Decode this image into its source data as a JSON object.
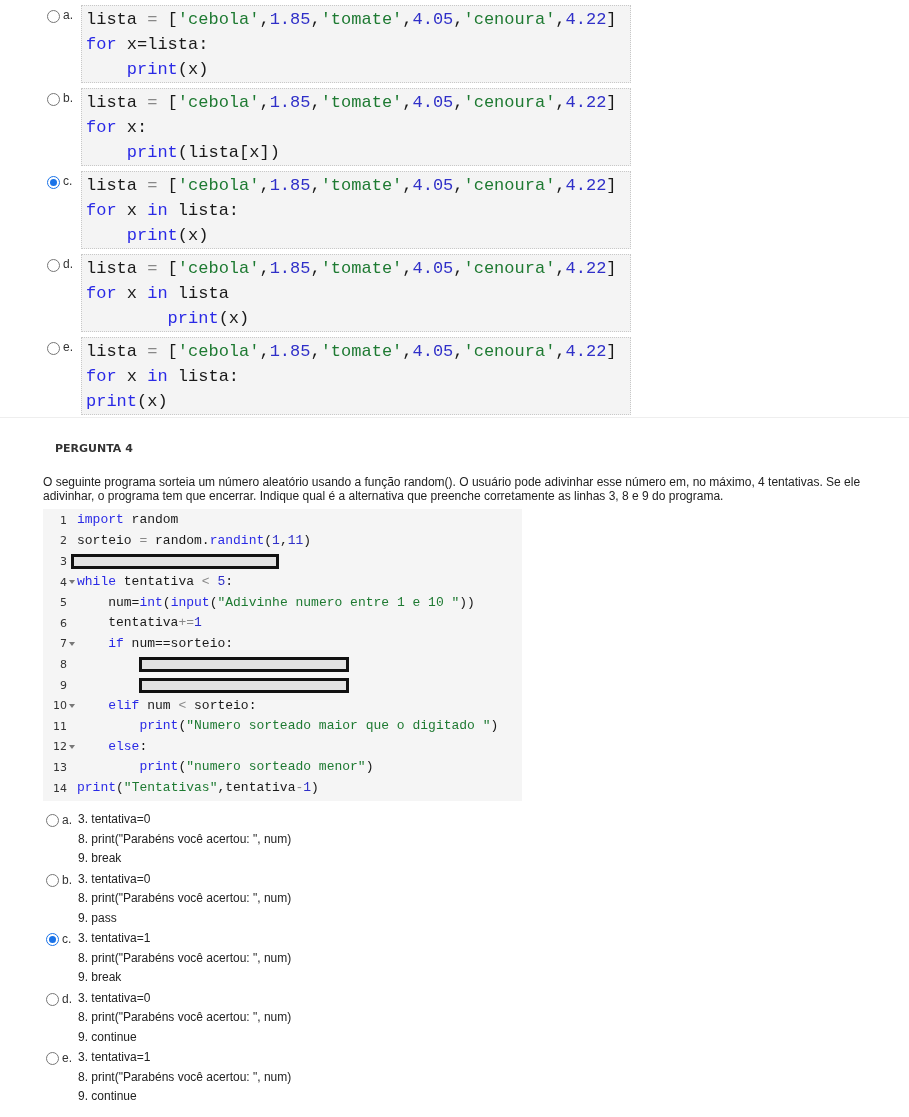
{
  "question_3": {
    "options": [
      {
        "letter": "a.",
        "selected": false,
        "lines": [
          [
            {
              "text": "lista ",
              "kind": "plain"
            },
            {
              "text": "=",
              "kind": "op"
            },
            {
              "text": " [",
              "kind": "plain"
            },
            {
              "text": "'cebola'",
              "kind": "str"
            },
            {
              "text": ",",
              "kind": "plain"
            },
            {
              "text": "1.85",
              "kind": "num"
            },
            {
              "text": ",",
              "kind": "plain"
            },
            {
              "text": "'tomate'",
              "kind": "str"
            },
            {
              "text": ",",
              "kind": "plain"
            },
            {
              "text": "4.05",
              "kind": "num"
            },
            {
              "text": ",",
              "kind": "plain"
            },
            {
              "text": "'cenoura'",
              "kind": "str"
            },
            {
              "text": ",",
              "kind": "plain"
            },
            {
              "text": "4.22",
              "kind": "num"
            },
            {
              "text": "]",
              "kind": "plain"
            }
          ],
          [
            {
              "text": "for",
              "kind": "kw"
            },
            {
              "text": " x=lista:",
              "kind": "plain"
            }
          ],
          [
            {
              "text": "    print",
              "kind": "kw"
            },
            {
              "text": "(x)",
              "kind": "plain"
            }
          ]
        ]
      },
      {
        "letter": "b.",
        "selected": false,
        "lines": [
          [
            {
              "text": "lista ",
              "kind": "plain"
            },
            {
              "text": "=",
              "kind": "op"
            },
            {
              "text": " [",
              "kind": "plain"
            },
            {
              "text": "'cebola'",
              "kind": "str"
            },
            {
              "text": ",",
              "kind": "plain"
            },
            {
              "text": "1.85",
              "kind": "num"
            },
            {
              "text": ",",
              "kind": "plain"
            },
            {
              "text": "'tomate'",
              "kind": "str"
            },
            {
              "text": ",",
              "kind": "plain"
            },
            {
              "text": "4.05",
              "kind": "num"
            },
            {
              "text": ",",
              "kind": "plain"
            },
            {
              "text": "'cenoura'",
              "kind": "str"
            },
            {
              "text": ",",
              "kind": "plain"
            },
            {
              "text": "4.22",
              "kind": "num"
            },
            {
              "text": "]",
              "kind": "plain"
            }
          ],
          [
            {
              "text": "for",
              "kind": "kw"
            },
            {
              "text": " x:",
              "kind": "plain"
            }
          ],
          [
            {
              "text": "    print",
              "kind": "kw"
            },
            {
              "text": "(lista[x])",
              "kind": "plain"
            }
          ]
        ]
      },
      {
        "letter": "c.",
        "selected": true,
        "lines": [
          [
            {
              "text": "lista ",
              "kind": "plain"
            },
            {
              "text": "=",
              "kind": "op"
            },
            {
              "text": " [",
              "kind": "plain"
            },
            {
              "text": "'cebola'",
              "kind": "str"
            },
            {
              "text": ",",
              "kind": "plain"
            },
            {
              "text": "1.85",
              "kind": "num"
            },
            {
              "text": ",",
              "kind": "plain"
            },
            {
              "text": "'tomate'",
              "kind": "str"
            },
            {
              "text": ",",
              "kind": "plain"
            },
            {
              "text": "4.05",
              "kind": "num"
            },
            {
              "text": ",",
              "kind": "plain"
            },
            {
              "text": "'cenoura'",
              "kind": "str"
            },
            {
              "text": ",",
              "kind": "plain"
            },
            {
              "text": "4.22",
              "kind": "num"
            },
            {
              "text": "]",
              "kind": "plain"
            }
          ],
          [
            {
              "text": "for",
              "kind": "kw"
            },
            {
              "text": " x ",
              "kind": "plain"
            },
            {
              "text": "in",
              "kind": "kw"
            },
            {
              "text": " lista:",
              "kind": "plain"
            }
          ],
          [
            {
              "text": "    print",
              "kind": "kw"
            },
            {
              "text": "(x)",
              "kind": "plain"
            }
          ]
        ]
      },
      {
        "letter": "d.",
        "selected": false,
        "lines": [
          [
            {
              "text": "lista ",
              "kind": "plain"
            },
            {
              "text": "=",
              "kind": "op"
            },
            {
              "text": " [",
              "kind": "plain"
            },
            {
              "text": "'cebola'",
              "kind": "str"
            },
            {
              "text": ",",
              "kind": "plain"
            },
            {
              "text": "1.85",
              "kind": "num"
            },
            {
              "text": ",",
              "kind": "plain"
            },
            {
              "text": "'tomate'",
              "kind": "str"
            },
            {
              "text": ",",
              "kind": "plain"
            },
            {
              "text": "4.05",
              "kind": "num"
            },
            {
              "text": ",",
              "kind": "plain"
            },
            {
              "text": "'cenoura'",
              "kind": "str"
            },
            {
              "text": ",",
              "kind": "plain"
            },
            {
              "text": "4.22",
              "kind": "num"
            },
            {
              "text": "]",
              "kind": "plain"
            }
          ],
          [
            {
              "text": "for",
              "kind": "kw"
            },
            {
              "text": " x ",
              "kind": "plain"
            },
            {
              "text": "in",
              "kind": "kw"
            },
            {
              "text": " lista",
              "kind": "plain"
            }
          ],
          [
            {
              "text": "        print",
              "kind": "kw"
            },
            {
              "text": "(x)",
              "kind": "plain"
            }
          ]
        ]
      },
      {
        "letter": "e.",
        "selected": false,
        "lines": [
          [
            {
              "text": "lista ",
              "kind": "plain"
            },
            {
              "text": "=",
              "kind": "op"
            },
            {
              "text": " [",
              "kind": "plain"
            },
            {
              "text": "'cebola'",
              "kind": "str"
            },
            {
              "text": ",",
              "kind": "plain"
            },
            {
              "text": "1.85",
              "kind": "num"
            },
            {
              "text": ",",
              "kind": "plain"
            },
            {
              "text": "'tomate'",
              "kind": "str"
            },
            {
              "text": ",",
              "kind": "plain"
            },
            {
              "text": "4.05",
              "kind": "num"
            },
            {
              "text": ",",
              "kind": "plain"
            },
            {
              "text": "'cenoura'",
              "kind": "str"
            },
            {
              "text": ",",
              "kind": "plain"
            },
            {
              "text": "4.22",
              "kind": "num"
            },
            {
              "text": "]",
              "kind": "plain"
            }
          ],
          [
            {
              "text": "for",
              "kind": "kw"
            },
            {
              "text": " x ",
              "kind": "plain"
            },
            {
              "text": "in",
              "kind": "kw"
            },
            {
              "text": " lista:",
              "kind": "plain"
            }
          ],
          [
            {
              "text": "print",
              "kind": "kw"
            },
            {
              "text": "(x)",
              "kind": "plain"
            }
          ]
        ]
      }
    ]
  },
  "question_4": {
    "title": "PERGUNTA 4",
    "prompt": "O seguinte programa sorteia um número aleatório usando a função random(). O usuário pode adivinhar esse número em, no máximo, 4 tentativas. Se ele adivinhar, o programa tem que encerrar. Indique qual é a alternativa que preenche corretamente as linhas 3, 8 e 9 do programa.",
    "code": [
      {
        "number": "1",
        "fold": false,
        "kind": "code",
        "tokens": [
          {
            "text": "import",
            "kind": "kw"
          },
          {
            "text": " random",
            "kind": "plain"
          }
        ]
      },
      {
        "number": "2",
        "fold": false,
        "kind": "code",
        "tokens": [
          {
            "text": "sorteio ",
            "kind": "plain"
          },
          {
            "text": "=",
            "kind": "op"
          },
          {
            "text": " random.",
            "kind": "plain"
          },
          {
            "text": "randint",
            "kind": "kw"
          },
          {
            "text": "(",
            "kind": "plain"
          },
          {
            "text": "1",
            "kind": "num"
          },
          {
            "text": ",",
            "kind": "plain"
          },
          {
            "text": "11",
            "kind": "num"
          },
          {
            "text": ")",
            "kind": "plain"
          }
        ]
      },
      {
        "number": "3",
        "fold": false,
        "kind": "blank",
        "nested": false
      },
      {
        "number": "4",
        "fold": true,
        "kind": "code",
        "tokens": [
          {
            "text": "while",
            "kind": "kw"
          },
          {
            "text": " tentativa ",
            "kind": "plain"
          },
          {
            "text": "<",
            "kind": "op"
          },
          {
            "text": " 5",
            "kind": "num"
          },
          {
            "text": ":",
            "kind": "plain"
          }
        ]
      },
      {
        "number": "5",
        "fold": false,
        "kind": "code",
        "tokens": [
          {
            "text": "    num=",
            "kind": "plain"
          },
          {
            "text": "int",
            "kind": "kw"
          },
          {
            "text": "(",
            "kind": "plain"
          },
          {
            "text": "input",
            "kind": "kw"
          },
          {
            "text": "(",
            "kind": "plain"
          },
          {
            "text": "\"Adivinhe numero entre 1 e 10 \"",
            "kind": "str"
          },
          {
            "text": "))",
            "kind": "plain"
          }
        ]
      },
      {
        "number": "6",
        "fold": false,
        "kind": "code",
        "tokens": [
          {
            "text": "    tentativa",
            "kind": "plain"
          },
          {
            "text": "+=",
            "kind": "op"
          },
          {
            "text": "1",
            "kind": "num"
          }
        ]
      },
      {
        "number": "7",
        "fold": true,
        "kind": "code",
        "tokens": [
          {
            "text": "    if",
            "kind": "kw"
          },
          {
            "text": " num==sorteio:",
            "kind": "plain"
          }
        ]
      },
      {
        "number": "8",
        "fold": false,
        "kind": "blank",
        "nested": true
      },
      {
        "number": "9",
        "fold": false,
        "kind": "blank",
        "nested": true
      },
      {
        "number": "10",
        "fold": true,
        "kind": "code",
        "tokens": [
          {
            "text": "    elif",
            "kind": "kw"
          },
          {
            "text": " num ",
            "kind": "plain"
          },
          {
            "text": "<",
            "kind": "op"
          },
          {
            "text": " sorteio:",
            "kind": "plain"
          }
        ]
      },
      {
        "number": "11",
        "fold": false,
        "kind": "code",
        "tokens": [
          {
            "text": "        print",
            "kind": "kw"
          },
          {
            "text": "(",
            "kind": "plain"
          },
          {
            "text": "\"Numero sorteado maior que o digitado \"",
            "kind": "str"
          },
          {
            "text": ")",
            "kind": "plain"
          }
        ]
      },
      {
        "number": "12",
        "fold": true,
        "kind": "code",
        "tokens": [
          {
            "text": "    else",
            "kind": "kw"
          },
          {
            "text": ":",
            "kind": "plain"
          }
        ]
      },
      {
        "number": "13",
        "fold": false,
        "kind": "code",
        "tokens": [
          {
            "text": "        print",
            "kind": "kw"
          },
          {
            "text": "(",
            "kind": "plain"
          },
          {
            "text": "\"numero sorteado menor\"",
            "kind": "str"
          },
          {
            "text": ")",
            "kind": "plain"
          }
        ]
      },
      {
        "number": "14",
        "fold": false,
        "kind": "code",
        "tokens": [
          {
            "text": "print",
            "kind": "kw"
          },
          {
            "text": "(",
            "kind": "plain"
          },
          {
            "text": "\"Tentativas\"",
            "kind": "str"
          },
          {
            "text": ",tentativa",
            "kind": "plain"
          },
          {
            "text": "-",
            "kind": "op"
          },
          {
            "text": "1",
            "kind": "num"
          },
          {
            "text": ")",
            "kind": "plain"
          }
        ]
      }
    ],
    "options": [
      {
        "letter": "a.",
        "selected": false,
        "lines": [
          "3. tentativa=0",
          "8. print(\"Parabéns você acertou: \", num)",
          "9. break"
        ]
      },
      {
        "letter": "b.",
        "selected": false,
        "lines": [
          "3. tentativa=0",
          "8. print(\"Parabéns você acertou: \", num)",
          "9. pass"
        ]
      },
      {
        "letter": "c.",
        "selected": true,
        "lines": [
          "3. tentativa=1",
          "8. print(\"Parabéns você acertou: \", num)",
          "9. break"
        ]
      },
      {
        "letter": "d.",
        "selected": false,
        "lines": [
          "3. tentativa=0",
          "8. print(\"Parabéns você acertou: \", num)",
          "9. continue"
        ]
      },
      {
        "letter": "e.",
        "selected": false,
        "lines": [
          "3. tentativa=1",
          "8. print(\"Parabéns você acertou: \", num)",
          "9. continue"
        ]
      }
    ]
  }
}
